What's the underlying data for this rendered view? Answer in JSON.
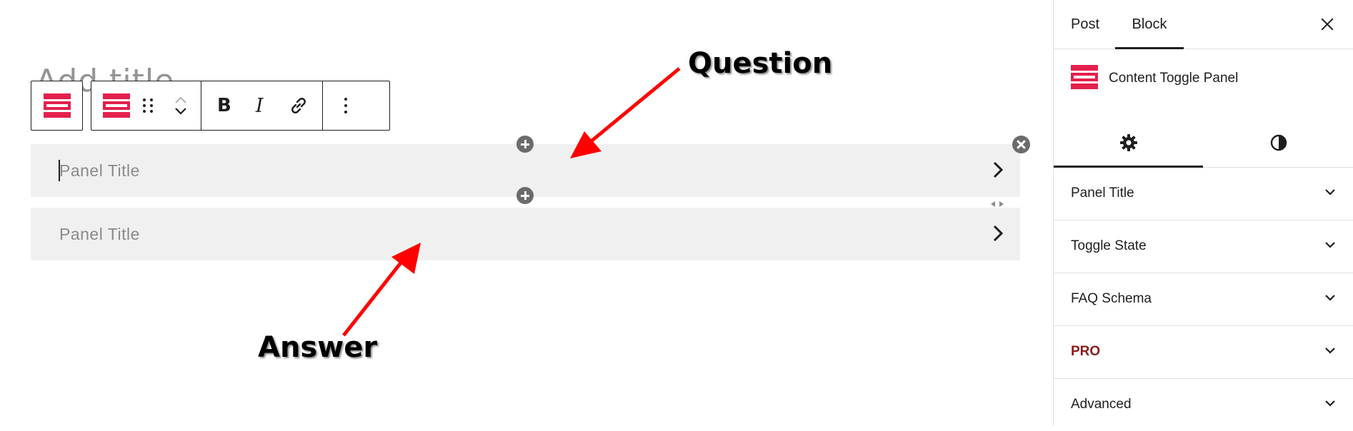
{
  "editor": {
    "title_placeholder": "Add title",
    "panels": [
      {
        "title_placeholder": "Panel Title"
      },
      {
        "title_placeholder": "Panel Title"
      }
    ],
    "toolbar": {
      "parent_icon": "content-toggle-block-icon",
      "block_icon": "content-toggle-panel-icon",
      "drag_icon": "drag-handle-icon",
      "move_up_icon": "chevron-up-icon",
      "move_down_icon": "chevron-down-icon",
      "bold_label": "B",
      "italic_label": "I",
      "link_icon": "link-icon",
      "options_icon": "more-vertical-icon"
    },
    "annotations": {
      "question": "Question",
      "answer": "Answer"
    },
    "colors": {
      "accent": "#e3204c",
      "arrow": "#ff0000",
      "panel_bg": "#f0f0f0"
    }
  },
  "sidebar": {
    "tabs": [
      {
        "label": "Post"
      },
      {
        "label": "Block"
      }
    ],
    "active_tab": "Block",
    "close_icon": "close-icon",
    "block_card": {
      "icon": "content-toggle-panel-icon",
      "title": "Content Toggle Panel"
    },
    "subtabs": [
      {
        "icon": "gear-icon"
      },
      {
        "icon": "half-circle-contrast-icon"
      }
    ],
    "sections": [
      {
        "label": "Panel Title"
      },
      {
        "label": "Toggle State"
      },
      {
        "label": "FAQ Schema"
      },
      {
        "label": "PRO"
      },
      {
        "label": "Advanced"
      }
    ],
    "pro_color": "#8a1c1c"
  }
}
